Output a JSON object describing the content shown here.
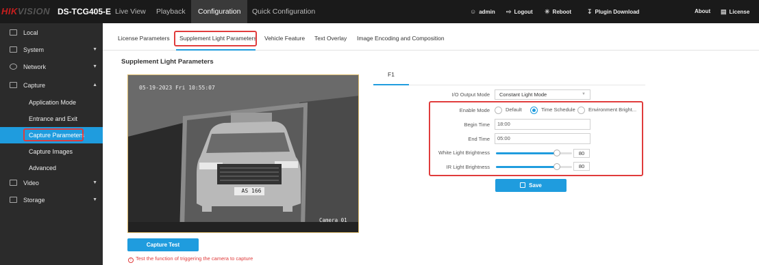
{
  "brand": {
    "logo_prefix": "HIK",
    "logo_suffix": "VISION",
    "model": "DS-TCG405-E"
  },
  "nav": {
    "items": [
      {
        "label": "Live View",
        "active": false
      },
      {
        "label": "Playback",
        "active": false
      },
      {
        "label": "Configuration",
        "active": true
      },
      {
        "label": "Quick Configuration",
        "active": false
      }
    ]
  },
  "topbar_right": {
    "user": "admin",
    "logout": "Logout",
    "reboot": "Reboot",
    "plugin": "Plugin Download",
    "about": "About",
    "license": "License"
  },
  "sidebar": {
    "items": [
      {
        "label": "Local",
        "icon": "monitor-icon"
      },
      {
        "label": "System",
        "icon": "system-icon"
      },
      {
        "label": "Network",
        "icon": "globe-icon"
      },
      {
        "label": "Capture",
        "icon": "camera-icon"
      },
      {
        "label": "Video",
        "icon": "video-icon"
      },
      {
        "label": "Storage",
        "icon": "storage-icon"
      }
    ],
    "capture_sub": [
      {
        "label": "Application Mode"
      },
      {
        "label": "Entrance and Exit"
      },
      {
        "label": "Capture Parameters",
        "active": true
      },
      {
        "label": "Capture Images"
      },
      {
        "label": "Advanced"
      }
    ]
  },
  "tabs": [
    {
      "label": "License Parameters"
    },
    {
      "label": "Supplement Light Parameters",
      "active": true
    },
    {
      "label": "Vehicle Feature"
    },
    {
      "label": "Text Overlay"
    },
    {
      "label": "Image Encoding and Composition"
    }
  ],
  "section_title": "Supplement Light Parameters",
  "video": {
    "osd_time": "05-19-2023 Fri 10:55:07",
    "osd_camera": "Camera 01",
    "plate": "AS 166"
  },
  "capture_test_label": "Capture Test",
  "capture_hint": "Test the function of triggering the camera to capture",
  "form": {
    "tab": "F1",
    "io_output_mode": {
      "label": "I/O Output Mode",
      "value": "Constant Light Mode"
    },
    "enable_mode": {
      "label": "Enable Mode",
      "options": [
        "Default",
        "Time Schedule",
        "Environment Bright..."
      ],
      "selected": "Time Schedule"
    },
    "begin_time": {
      "label": "Begin Time",
      "value": "18:00"
    },
    "end_time": {
      "label": "End Time",
      "value": "05:00"
    },
    "white_light": {
      "label": "White Light Brightness",
      "value": "80",
      "level": 0.8
    },
    "ir_light": {
      "label": "IR Light Brightness",
      "value": "80",
      "level": 0.8
    },
    "save_label": "Save"
  },
  "colors": {
    "accent": "#1f9cde",
    "highlight": "#e03b3b",
    "sidebar": "#2b2b2b",
    "topbar": "#1a1a1a"
  }
}
